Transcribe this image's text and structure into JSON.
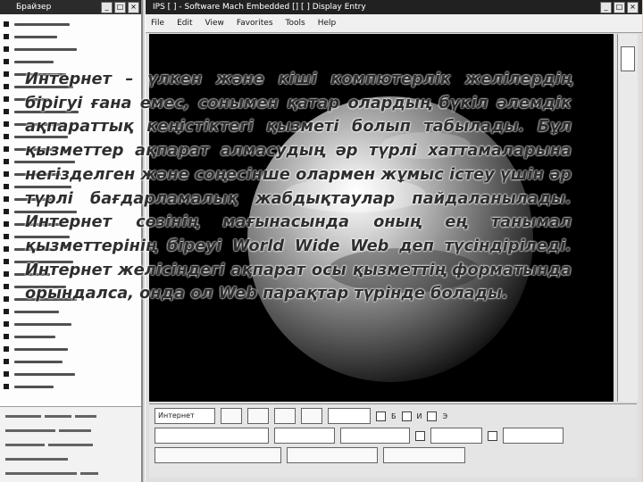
{
  "left_window": {
    "title": "Брайзер",
    "rows": [
      "",
      "",
      "",
      "",
      "",
      "",
      "",
      "",
      "",
      "",
      "",
      "",
      "",
      "",
      "",
      "",
      "",
      "",
      "",
      "",
      "",
      "",
      "",
      "",
      "",
      "",
      "",
      "",
      "",
      ""
    ]
  },
  "right_window": {
    "title": "IPS [ ] - Software Mach Embedded [] [ ] Display Entry",
    "menu": [
      "File",
      "Edit",
      "View",
      "Favorites",
      "Tools",
      "Help"
    ],
    "toolbar": {
      "field1": "Интернет",
      "field2": "",
      "option1": "Б",
      "option2": "И",
      "option3": "Э"
    }
  },
  "overlay": {
    "paragraph": "Интернет – үлкен және кіші компютерлік желілердің бірігуі ғана емес, сонымен қатар олардың бүкіл әлемдік ақпараттық кеңістіктегі қызметі болып табылады. Бұл қызметтер ақпарат алмасудың әр түрлі хаттамаларына негізделген және соңесінше олармен жұмыс істеу үшін әр түрлі бағдарламалық жабдықтаулар пайдаланылады. Интернет сөзінің мағынасында оның ең танымал қызметтерінің біреуі World Wide Web деп түсіндіріледі. Интернет желісіндегі ақпарат осы қызметтің форматында орындалса, онда ол Web парақтар түрінде болады."
  },
  "colors": {
    "text": "#6f1f6f",
    "viewport": "#000000"
  }
}
